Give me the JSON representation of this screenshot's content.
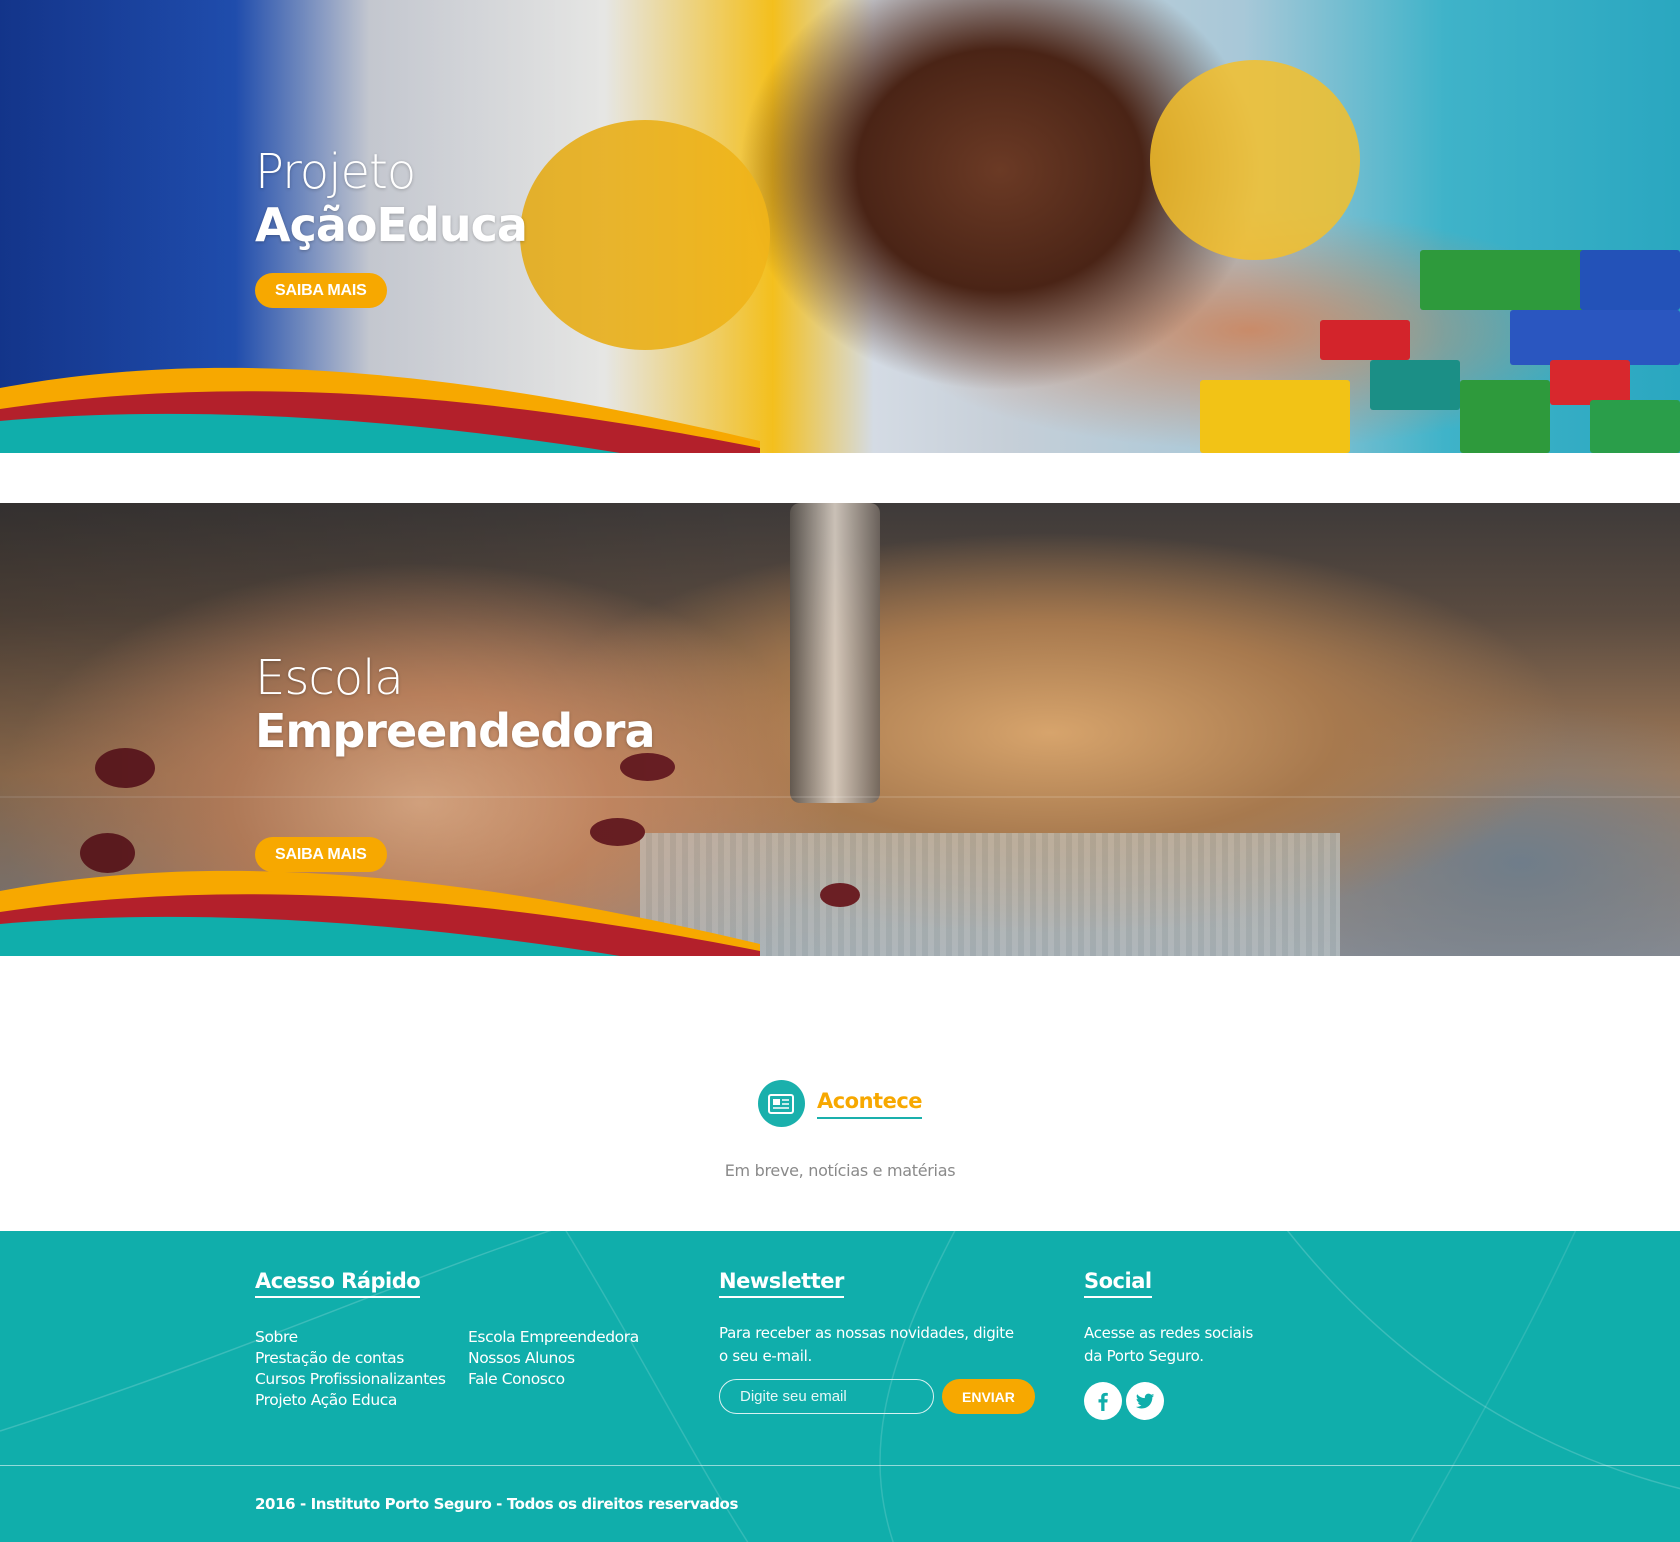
{
  "banners": [
    {
      "line1": "Projeto",
      "line2": "AçãoEduca",
      "button": "SAIBA MAIS"
    },
    {
      "line1": "Escola",
      "line2": "Empreendedora",
      "button": "SAIBA MAIS"
    }
  ],
  "acontece": {
    "title": "Acontece",
    "icon": "newspaper-icon",
    "subtitle": "Em breve, notícias e matérias"
  },
  "footer": {
    "quick_access": {
      "title": "Acesso Rápido",
      "col1": [
        "Sobre",
        "Prestação de contas",
        "Cursos Profissionalizantes",
        "Projeto Ação Educa"
      ],
      "col2": [
        "Escola Empreendedora",
        "Nossos Alunos",
        "Fale Conosco"
      ]
    },
    "newsletter": {
      "title": "Newsletter",
      "text": "Para receber as nossas novidades, digite o seu e-mail.",
      "placeholder": "Digite seu email",
      "button": "ENVIAR"
    },
    "social": {
      "title": "Social",
      "text": "Acesse as redes sociais da Porto Seguro.",
      "icons": [
        "facebook-icon",
        "twitter-icon"
      ]
    },
    "copyright": "2016 - Instituto Porto Seguro - Todos os direitos reservados"
  },
  "colors": {
    "accent_orange": "#f7a800",
    "teal": "#10aeab",
    "curve_red": "#b3202b"
  }
}
